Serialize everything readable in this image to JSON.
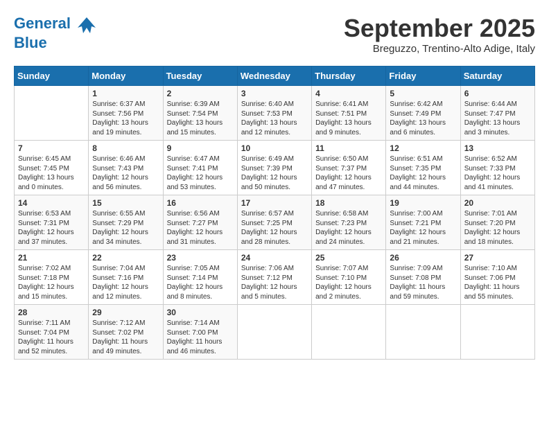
{
  "header": {
    "logo_line1": "General",
    "logo_line2": "Blue",
    "month": "September 2025",
    "location": "Breguzzo, Trentino-Alto Adige, Italy"
  },
  "days_of_week": [
    "Sunday",
    "Monday",
    "Tuesday",
    "Wednesday",
    "Thursday",
    "Friday",
    "Saturday"
  ],
  "weeks": [
    [
      {
        "day": "",
        "content": ""
      },
      {
        "day": "1",
        "content": "Sunrise: 6:37 AM\nSunset: 7:56 PM\nDaylight: 13 hours\nand 19 minutes."
      },
      {
        "day": "2",
        "content": "Sunrise: 6:39 AM\nSunset: 7:54 PM\nDaylight: 13 hours\nand 15 minutes."
      },
      {
        "day": "3",
        "content": "Sunrise: 6:40 AM\nSunset: 7:53 PM\nDaylight: 13 hours\nand 12 minutes."
      },
      {
        "day": "4",
        "content": "Sunrise: 6:41 AM\nSunset: 7:51 PM\nDaylight: 13 hours\nand 9 minutes."
      },
      {
        "day": "5",
        "content": "Sunrise: 6:42 AM\nSunset: 7:49 PM\nDaylight: 13 hours\nand 6 minutes."
      },
      {
        "day": "6",
        "content": "Sunrise: 6:44 AM\nSunset: 7:47 PM\nDaylight: 13 hours\nand 3 minutes."
      }
    ],
    [
      {
        "day": "7",
        "content": "Sunrise: 6:45 AM\nSunset: 7:45 PM\nDaylight: 13 hours\nand 0 minutes."
      },
      {
        "day": "8",
        "content": "Sunrise: 6:46 AM\nSunset: 7:43 PM\nDaylight: 12 hours\nand 56 minutes."
      },
      {
        "day": "9",
        "content": "Sunrise: 6:47 AM\nSunset: 7:41 PM\nDaylight: 12 hours\nand 53 minutes."
      },
      {
        "day": "10",
        "content": "Sunrise: 6:49 AM\nSunset: 7:39 PM\nDaylight: 12 hours\nand 50 minutes."
      },
      {
        "day": "11",
        "content": "Sunrise: 6:50 AM\nSunset: 7:37 PM\nDaylight: 12 hours\nand 47 minutes."
      },
      {
        "day": "12",
        "content": "Sunrise: 6:51 AM\nSunset: 7:35 PM\nDaylight: 12 hours\nand 44 minutes."
      },
      {
        "day": "13",
        "content": "Sunrise: 6:52 AM\nSunset: 7:33 PM\nDaylight: 12 hours\nand 41 minutes."
      }
    ],
    [
      {
        "day": "14",
        "content": "Sunrise: 6:53 AM\nSunset: 7:31 PM\nDaylight: 12 hours\nand 37 minutes."
      },
      {
        "day": "15",
        "content": "Sunrise: 6:55 AM\nSunset: 7:29 PM\nDaylight: 12 hours\nand 34 minutes."
      },
      {
        "day": "16",
        "content": "Sunrise: 6:56 AM\nSunset: 7:27 PM\nDaylight: 12 hours\nand 31 minutes."
      },
      {
        "day": "17",
        "content": "Sunrise: 6:57 AM\nSunset: 7:25 PM\nDaylight: 12 hours\nand 28 minutes."
      },
      {
        "day": "18",
        "content": "Sunrise: 6:58 AM\nSunset: 7:23 PM\nDaylight: 12 hours\nand 24 minutes."
      },
      {
        "day": "19",
        "content": "Sunrise: 7:00 AM\nSunset: 7:21 PM\nDaylight: 12 hours\nand 21 minutes."
      },
      {
        "day": "20",
        "content": "Sunrise: 7:01 AM\nSunset: 7:20 PM\nDaylight: 12 hours\nand 18 minutes."
      }
    ],
    [
      {
        "day": "21",
        "content": "Sunrise: 7:02 AM\nSunset: 7:18 PM\nDaylight: 12 hours\nand 15 minutes."
      },
      {
        "day": "22",
        "content": "Sunrise: 7:04 AM\nSunset: 7:16 PM\nDaylight: 12 hours\nand 12 minutes."
      },
      {
        "day": "23",
        "content": "Sunrise: 7:05 AM\nSunset: 7:14 PM\nDaylight: 12 hours\nand 8 minutes."
      },
      {
        "day": "24",
        "content": "Sunrise: 7:06 AM\nSunset: 7:12 PM\nDaylight: 12 hours\nand 5 minutes."
      },
      {
        "day": "25",
        "content": "Sunrise: 7:07 AM\nSunset: 7:10 PM\nDaylight: 12 hours\nand 2 minutes."
      },
      {
        "day": "26",
        "content": "Sunrise: 7:09 AM\nSunset: 7:08 PM\nDaylight: 11 hours\nand 59 minutes."
      },
      {
        "day": "27",
        "content": "Sunrise: 7:10 AM\nSunset: 7:06 PM\nDaylight: 11 hours\nand 55 minutes."
      }
    ],
    [
      {
        "day": "28",
        "content": "Sunrise: 7:11 AM\nSunset: 7:04 PM\nDaylight: 11 hours\nand 52 minutes."
      },
      {
        "day": "29",
        "content": "Sunrise: 7:12 AM\nSunset: 7:02 PM\nDaylight: 11 hours\nand 49 minutes."
      },
      {
        "day": "30",
        "content": "Sunrise: 7:14 AM\nSunset: 7:00 PM\nDaylight: 11 hours\nand 46 minutes."
      },
      {
        "day": "",
        "content": ""
      },
      {
        "day": "",
        "content": ""
      },
      {
        "day": "",
        "content": ""
      },
      {
        "day": "",
        "content": ""
      }
    ]
  ]
}
